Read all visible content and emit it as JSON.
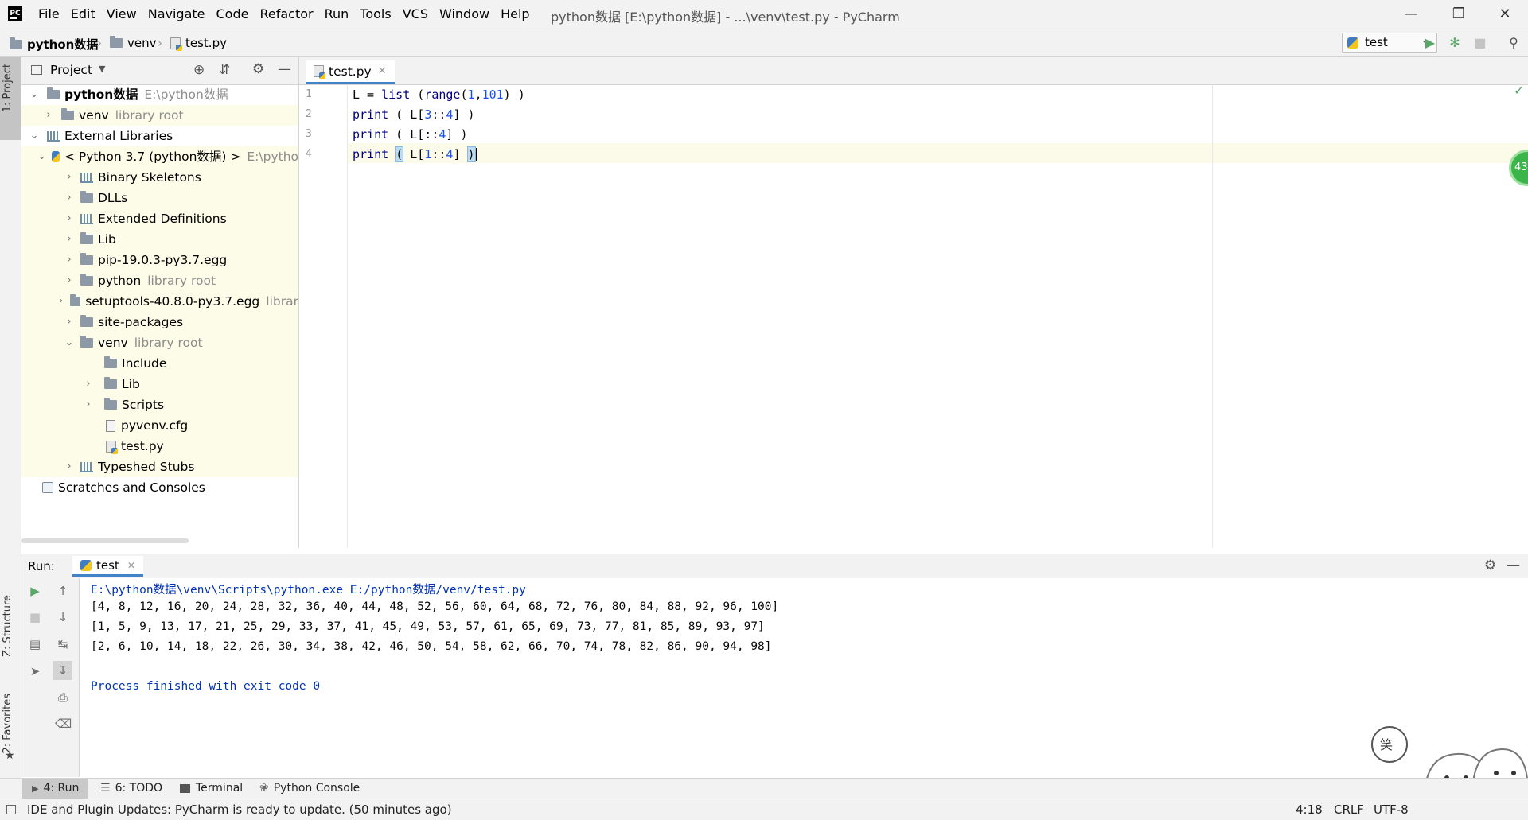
{
  "titlebar": {
    "menu": [
      "File",
      "Edit",
      "View",
      "Navigate",
      "Code",
      "Refactor",
      "Run",
      "Tools",
      "VCS",
      "Window",
      "Help"
    ],
    "window_title": "python数据 [E:\\python数据] - ...\\venv\\test.py - PyCharm",
    "logo_text": "PC"
  },
  "breadcrumb": {
    "project": "python数据",
    "folder": "venv",
    "file": "test.py"
  },
  "toolbar": {
    "run_config": "test"
  },
  "left_strip": {
    "project_tab": "1: Project",
    "structure_tab": "Z: Structure",
    "favorites_tab": "2: Favorites"
  },
  "project_panel": {
    "title": "Project",
    "tree": [
      {
        "label": "python数据",
        "hint": "E:\\python数据"
      },
      {
        "label": "venv",
        "hint": "library root"
      },
      {
        "label": "External Libraries",
        "hint": ""
      },
      {
        "label": "< Python 3.7 (python数据) >",
        "hint": "E:\\pytho"
      },
      {
        "label": "Binary Skeletons",
        "hint": ""
      },
      {
        "label": "DLLs",
        "hint": ""
      },
      {
        "label": "Extended Definitions",
        "hint": ""
      },
      {
        "label": "Lib",
        "hint": ""
      },
      {
        "label": "pip-19.0.3-py3.7.egg",
        "hint": ""
      },
      {
        "label": "python",
        "hint": "library root"
      },
      {
        "label": "setuptools-40.8.0-py3.7.egg",
        "hint": "librar"
      },
      {
        "label": "site-packages",
        "hint": ""
      },
      {
        "label": "venv",
        "hint": "library root"
      },
      {
        "label": "Include",
        "hint": ""
      },
      {
        "label": "Lib",
        "hint": ""
      },
      {
        "label": "Scripts",
        "hint": ""
      },
      {
        "label": "pyvenv.cfg",
        "hint": ""
      },
      {
        "label": "test.py",
        "hint": ""
      },
      {
        "label": "Typeshed Stubs",
        "hint": ""
      },
      {
        "label": "Scratches and Consoles",
        "hint": ""
      }
    ]
  },
  "editor": {
    "tab_label": "test.py",
    "line_numbers": [
      "1",
      "2",
      "3",
      "4"
    ],
    "lines": [
      {
        "a": "L = ",
        "kw": "list",
        "b": " (",
        "kw2": "range",
        "c": "(",
        "n1": "1",
        "d": ",",
        "n2": "101",
        "e": ") )"
      },
      {
        "kw": "print",
        "b": " ( L[",
        "n1": "3",
        "c": "::",
        "n2": "4",
        "d": "] )"
      },
      {
        "kw": "print",
        "b": " ( L[::",
        "n1": "4",
        "c": "] )"
      },
      {
        "kw": "print",
        "b": " ",
        "p1": "(",
        "c": " L[",
        "n1": "1",
        "d": "::",
        "n2": "4",
        "e": "] ",
        "p2": ")"
      }
    ],
    "plugin_badge": "43"
  },
  "run_panel": {
    "label": "Run:",
    "tab": "test",
    "console": [
      "E:\\python数据\\venv\\Scripts\\python.exe E:/python数据/venv/test.py",
      "[4, 8, 12, 16, 20, 24, 28, 32, 36, 40, 44, 48, 52, 56, 60, 64, 68, 72, 76, 80, 84, 88, 92, 96, 100]",
      "[1, 5, 9, 13, 17, 21, 25, 29, 33, 37, 41, 45, 49, 53, 57, 61, 65, 69, 73, 77, 81, 85, 89, 93, 97]",
      "[2, 6, 10, 14, 18, 22, 26, 30, 34, 38, 42, 46, 50, 54, 58, 62, 66, 70, 74, 78, 82, 86, 90, 94, 98]",
      "",
      "Process finished with exit code 0"
    ]
  },
  "bottom_tabs": {
    "run": "4: Run",
    "todo": "6: TODO",
    "terminal": "Terminal",
    "python_console": "Python Console"
  },
  "statusbar": {
    "message": "IDE and Plugin Updates: PyCharm is ready to update. (50 minutes ago)",
    "position": "4:18",
    "line_sep": "CRLF",
    "encoding": "UTF-8"
  },
  "deco": {
    "bubble_text": "笑"
  },
  "colors": {
    "accent": "#4083c9",
    "keyword": "#000080",
    "number": "#1750eb",
    "run_green": "#59a869",
    "console_path": "#0033b3"
  }
}
